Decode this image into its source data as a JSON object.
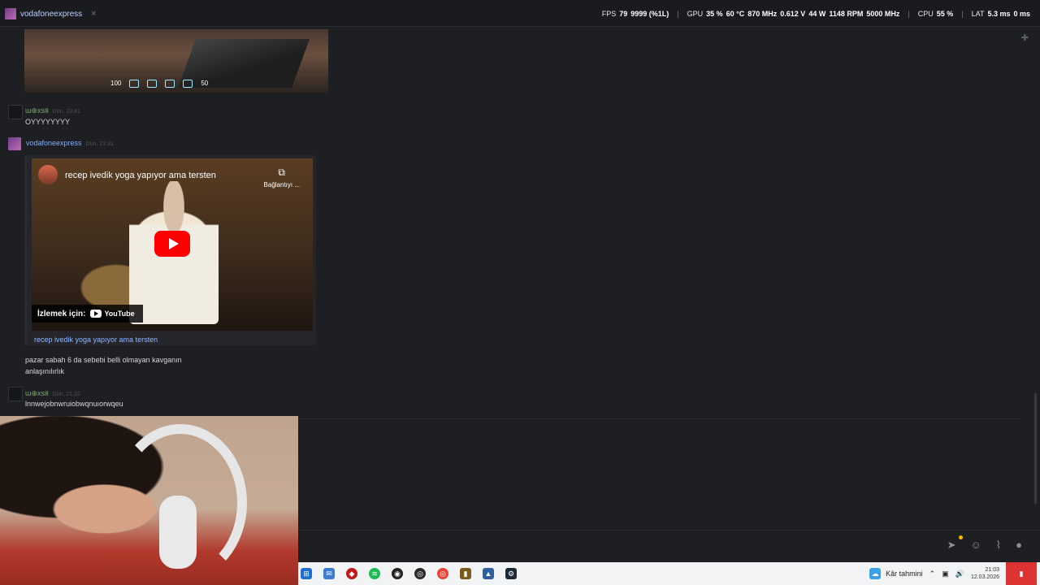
{
  "topbar": {
    "tab_label": "vodafoneexpress",
    "tab_close": "×",
    "osd": {
      "fps_label": "FPS",
      "fps_value": "79",
      "fps_extra": "9999 (%1L)",
      "gpu_label": "GPU",
      "gpu_load": "35 %",
      "gpu_temp": "60 °C",
      "gpu_clock": "870 MHz",
      "gpu_volt": "0.612 V",
      "gpu_power": "44 W",
      "gpu_fan": "1148 RPM",
      "gpu_mem": "5000 MHz",
      "cpu_label": "CPU",
      "cpu_load": "55 %",
      "lat_label": "LAT",
      "lat_value": "5.3 ms",
      "lat_value2": "0 ms"
    }
  },
  "embed_image": {
    "hud_health": "100",
    "hud_ammo": "50"
  },
  "messages": [
    {
      "author": "ɯ⊕xsiŧ",
      "time": "Dün, 19:41",
      "text": "OYYYYYYYY"
    },
    {
      "author": "vodafoneexpress",
      "time": "Dün, 21:31"
    },
    {
      "author": "ɯ⊕xsiŧ",
      "time": "Dün, 21:32",
      "text": "lnnwejobnwruiobwqnuıorwqeu"
    }
  ],
  "youtube": {
    "title": "recep ivedik yoga yapıyor ama tersten",
    "copy_label": "Bağlantıyı ...",
    "watch_label": "İzlemek için:",
    "logo_text": "YouTube",
    "link_text": "recep ivedik yoga yapıyor ama tersten"
  },
  "followup_text": [
    "pazar sabah 6 da sebebi belli olmayan kavganın",
    "anlaşınılırlık"
  ],
  "composer": {
    "send_icon": "send-icon",
    "emoji_icon": "emoji-icon",
    "attach_icon": "attach-icon",
    "mic_icon": "mic-icon"
  },
  "taskbar": {
    "weather_label": "Kâr tahmini",
    "clock_time": "21:03",
    "clock_date": "12.03.2026"
  },
  "colors": {
    "accent_blue": "#7eb0ff",
    "author_green": "#7aa86a",
    "youtube_red": "#ff0000"
  }
}
